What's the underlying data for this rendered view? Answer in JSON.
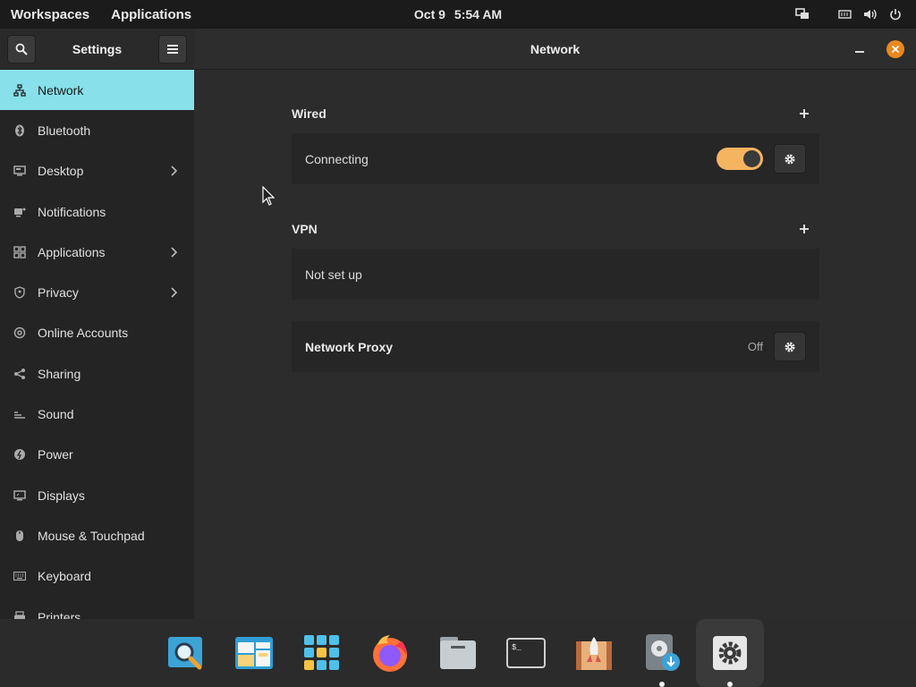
{
  "topbar": {
    "workspaces": "Workspaces",
    "applications": "Applications",
    "date": "Oct 9",
    "time": "5:54 AM",
    "tray_icons": [
      "display-icon",
      "battery-icon",
      "volume-icon",
      "power-icon"
    ]
  },
  "sidebar": {
    "title": "Settings",
    "items": [
      {
        "label": "Network",
        "icon": "network-icon",
        "active": true,
        "submenu": false
      },
      {
        "label": "Bluetooth",
        "icon": "bluetooth-icon",
        "active": false,
        "submenu": false
      },
      {
        "label": "Desktop",
        "icon": "desktop-icon",
        "active": false,
        "submenu": true
      },
      {
        "label": "Notifications",
        "icon": "notifications-icon",
        "active": false,
        "submenu": false
      },
      {
        "label": "Applications",
        "icon": "applications-grid-icon",
        "active": false,
        "submenu": true
      },
      {
        "label": "Privacy",
        "icon": "privacy-icon",
        "active": false,
        "submenu": true
      },
      {
        "label": "Online Accounts",
        "icon": "at-icon",
        "active": false,
        "submenu": false
      },
      {
        "label": "Sharing",
        "icon": "share-icon",
        "active": false,
        "submenu": false
      },
      {
        "label": "Sound",
        "icon": "sound-icon",
        "active": false,
        "submenu": false
      },
      {
        "label": "Power",
        "icon": "power-gauge-icon",
        "active": false,
        "submenu": false
      },
      {
        "label": "Displays",
        "icon": "displays-icon",
        "active": false,
        "submenu": false
      },
      {
        "label": "Mouse & Touchpad",
        "icon": "mouse-icon",
        "active": false,
        "submenu": false
      },
      {
        "label": "Keyboard",
        "icon": "keyboard-icon",
        "active": false,
        "submenu": false
      },
      {
        "label": "Printers",
        "icon": "printer-icon",
        "active": false,
        "submenu": false
      }
    ]
  },
  "main": {
    "title": "Network",
    "wired": {
      "heading": "Wired",
      "status": "Connecting",
      "enabled": true
    },
    "vpn": {
      "heading": "VPN",
      "status": "Not set up"
    },
    "proxy": {
      "label": "Network Proxy",
      "status": "Off"
    }
  },
  "dock": {
    "apps": [
      "search-app-icon",
      "file-manager-window-icon",
      "app-grid-icon",
      "firefox-icon",
      "files-icon",
      "terminal-icon",
      "launcher-rocket-icon",
      "installer-icon",
      "settings-gear-icon"
    ],
    "running_indicators": [
      false,
      false,
      false,
      false,
      false,
      false,
      false,
      true,
      true
    ],
    "active_index": 8
  },
  "colors": {
    "accent_active": "#87e0ea",
    "toggle_on": "#f4b460",
    "close_button": "#e8891f"
  }
}
